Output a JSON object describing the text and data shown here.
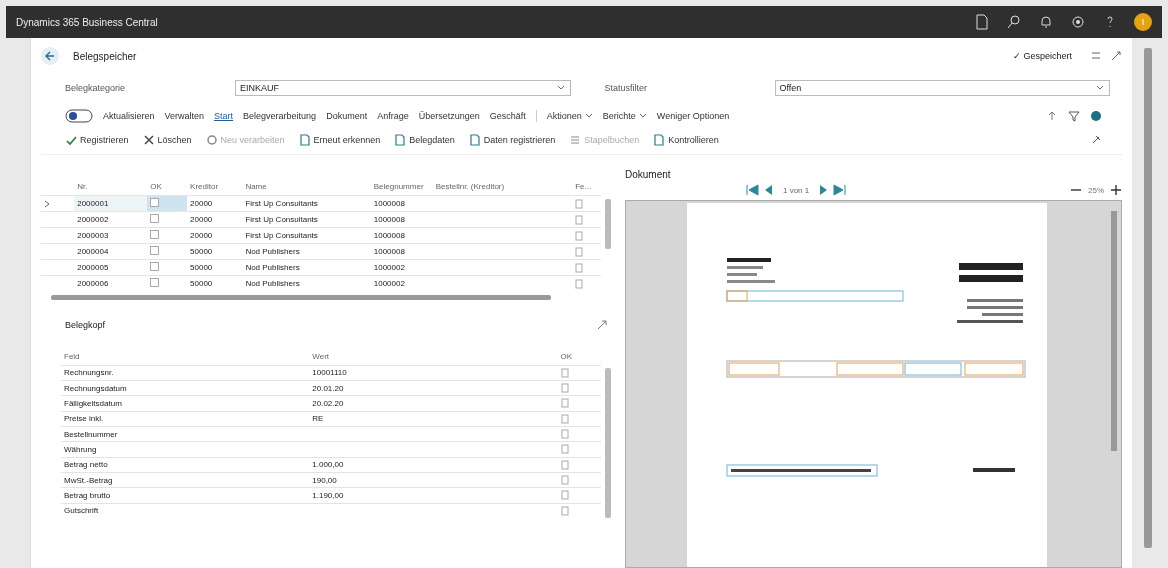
{
  "app_bar": {
    "title": "Dynamics 365 Business Central",
    "avatar": "I"
  },
  "page": {
    "title": "Belegspeicher",
    "saved": "✓ Gespeichert"
  },
  "fields": [
    {
      "label": "Belegkategorie",
      "value": "EINKAUF"
    },
    {
      "label": "Statusfilter",
      "value": "Offen"
    }
  ],
  "action_tabs": [
    {
      "label": "Aktualisieren",
      "selected": false,
      "dropdown": false
    },
    {
      "label": "Verwalten",
      "selected": false,
      "dropdown": false
    },
    {
      "label": "Start",
      "selected": true,
      "dropdown": false
    },
    {
      "label": "Belegverarbeitung",
      "selected": false,
      "dropdown": false
    },
    {
      "label": "Dokument",
      "selected": false,
      "dropdown": false
    },
    {
      "label": "Anfrage",
      "selected": false,
      "dropdown": false
    },
    {
      "label": "Übersetzungen",
      "selected": false,
      "dropdown": false
    },
    {
      "label": "Geschäft",
      "selected": false,
      "dropdown": false
    },
    {
      "label": "Aktionen",
      "selected": false,
      "dropdown": true
    },
    {
      "label": "Berichte",
      "selected": false,
      "dropdown": true
    },
    {
      "label": "Weniger Optionen",
      "selected": false,
      "dropdown": false
    }
  ],
  "actions": [
    {
      "label": "Registrieren",
      "kind": "check",
      "disabled": false
    },
    {
      "label": "Löschen",
      "kind": "cross",
      "disabled": false
    },
    {
      "label": "Neu verarbeiten",
      "kind": "gear",
      "disabled": true
    },
    {
      "label": "Erneut erkennen",
      "kind": "doc",
      "disabled": false
    },
    {
      "label": "Belegdaten",
      "kind": "doc",
      "disabled": false
    },
    {
      "label": "Daten registrieren",
      "kind": "doc",
      "disabled": false
    },
    {
      "label": "Stapelbuchen",
      "kind": "list",
      "disabled": true
    },
    {
      "label": "Kontrollieren",
      "kind": "doc",
      "disabled": false
    }
  ],
  "table": {
    "columns": [
      "Nr.",
      "OK",
      "Kreditor",
      "Name",
      "Belegnummer",
      "Bestellnr. (Kreditor)",
      "Fe..."
    ],
    "rows": [
      {
        "no": "2000001",
        "ok": false,
        "vendor": "20000",
        "name": "First Up Consultants",
        "doc": "1000008",
        "selected": true
      },
      {
        "no": "2000002",
        "ok": false,
        "vendor": "20000",
        "name": "First Up Consultants",
        "doc": "1000008",
        "selected": false
      },
      {
        "no": "2000003",
        "ok": false,
        "vendor": "20000",
        "name": "First Up Consultants",
        "doc": "1000008",
        "selected": false
      },
      {
        "no": "2000004",
        "ok": false,
        "vendor": "50000",
        "name": "Nod Publishers",
        "doc": "1000008",
        "selected": false
      },
      {
        "no": "2000005",
        "ok": false,
        "vendor": "50000",
        "name": "Nod Publishers",
        "doc": "1000002",
        "selected": false
      },
      {
        "no": "2000006",
        "ok": false,
        "vendor": "50000",
        "name": "Nod Publishers",
        "doc": "1000002",
        "selected": false
      }
    ]
  },
  "header_part": {
    "title": "Belegkopf",
    "columns": [
      "Feld",
      "Wert",
      "OK"
    ],
    "rows": [
      {
        "field": "Rechnungsnr.",
        "value": "10001110"
      },
      {
        "field": "Rechnungsdatum",
        "value": "20.01.20"
      },
      {
        "field": "Fälligkeitsdatum",
        "value": "20.02.20"
      },
      {
        "field": "Preise inkl.",
        "value": "RE"
      },
      {
        "field": "Bestellnummer",
        "value": ""
      },
      {
        "field": "Währung",
        "value": ""
      },
      {
        "field": "Betrag netto",
        "value": "1.000,00"
      },
      {
        "field": "MwSt.-Betrag",
        "value": "190,00"
      },
      {
        "field": "Betrag brutto",
        "value": "1.190,00"
      },
      {
        "field": "Gutschrift",
        "value": ""
      }
    ]
  },
  "document": {
    "title": "Dokument",
    "page": "1 von 1",
    "zoom": "25%"
  }
}
